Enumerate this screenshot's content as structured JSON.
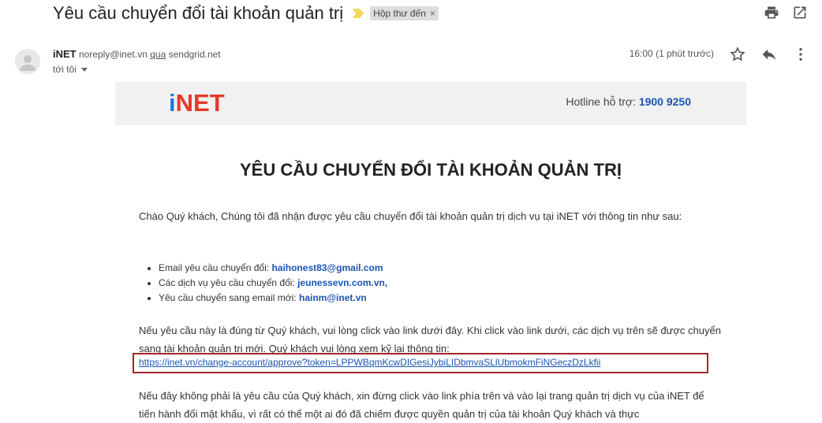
{
  "subject": "Yêu cầu chuyển đổi tài khoản quản trị",
  "label": "Hộp thư đến",
  "sender": {
    "name": "iNET",
    "address": "noreply@inet.vn",
    "via_word": "qua",
    "via_domain": "sendgrid.net",
    "to": "tới tôi"
  },
  "time": "16:00 (1 phút trước)",
  "banner": {
    "logo_i": "i",
    "logo_rest": "NET",
    "hotline_label": "Hotline hỗ trợ:",
    "hotline_number": "1900 9250"
  },
  "body": {
    "title": "YÊU CẦU CHUYỂN ĐỔI TÀI KHOẢN QUẢN TRỊ",
    "greeting": "Chào Quý khách, Chúng tôi đã nhận được yêu cầu chuyển đổi tài khoản quản trị dịch vụ tại iNET với thông tin như sau:",
    "bullets": [
      {
        "label": "Email yêu cầu chuyển đổi:",
        "value": "haihonest83@gmail.com"
      },
      {
        "label": "Các dịch vụ yêu cầu chuyển đổi:",
        "value": "jeunessevn.com.vn,"
      },
      {
        "label": "Yêu cầu chuyển sang email mới:",
        "value": "hainm@inet.vn"
      }
    ],
    "instruction": "Nếu yêu cầu này là đúng từ Quý khách, vui lòng click vào link dưới đây. Khi click vào link dưới, các dịch vụ trên sẽ được chuyển sang tài khoản quản trị mới. Quý khách vui lòng xem kỹ lại thông tin:",
    "approve_link": "https://inet.vn/change-account/approve?token=LPPWBqmKcwDIGesiJybiLIDbmvaSLlUbmokmFiNGeczDzLkfii",
    "warning": "Nếu đây không phải là yêu cầu của Quý khách, xin đừng click vào link phía trên và vào lại trang quản trị dịch vụ của iNET để tiến hành đổi mật khẩu, vì rất có thể một ai đó đã chiếm được quyền quản trị của tài khoản Quý khách và thực"
  },
  "colors": {
    "brand_blue": "#1a7bd3",
    "brand_red": "#e53a2b",
    "link": "#1a55b3",
    "highlight_border": "#a3252b"
  }
}
